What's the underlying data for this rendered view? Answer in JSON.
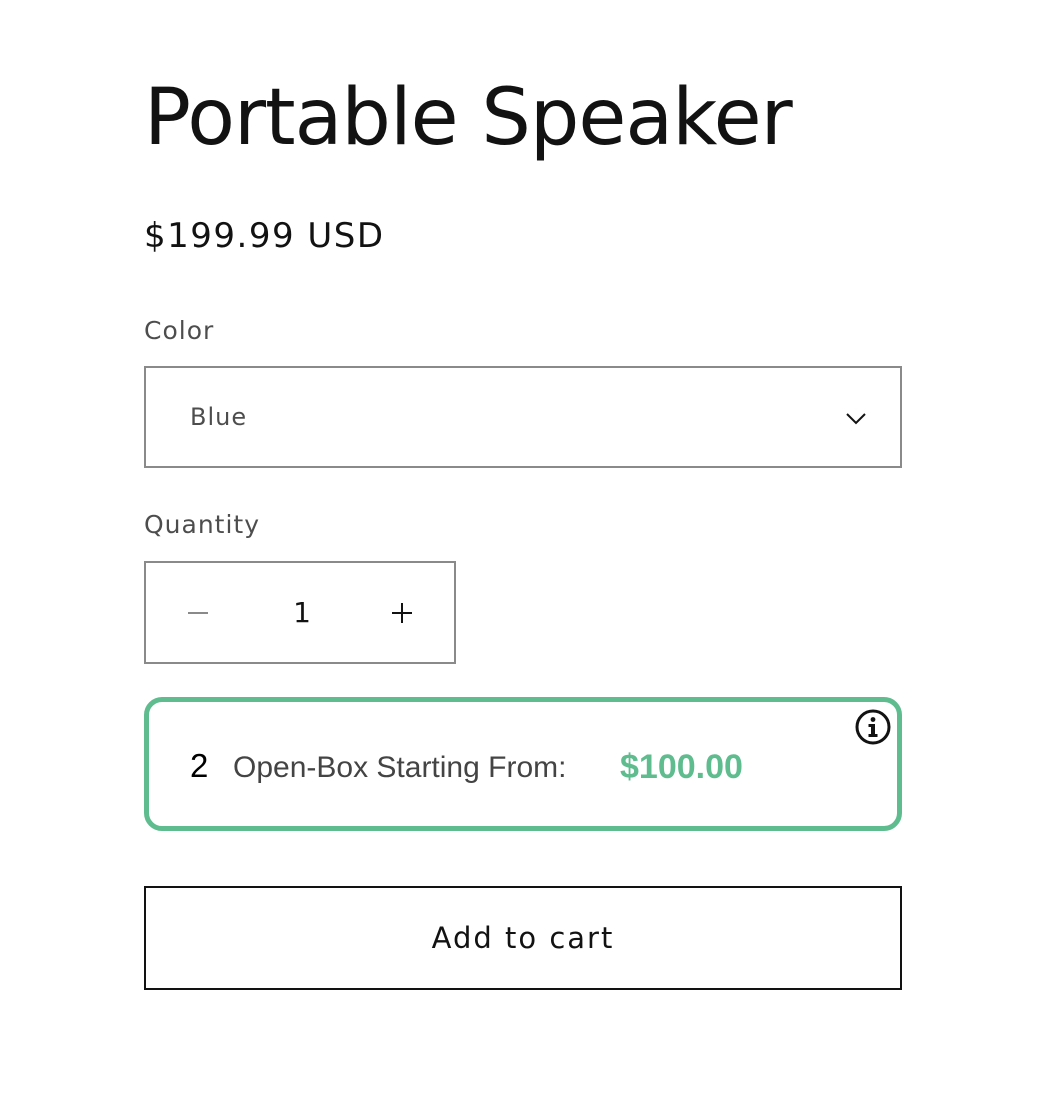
{
  "product": {
    "title": "Portable Speaker",
    "price": "$199.99 USD"
  },
  "color": {
    "label": "Color",
    "selected": "Blue",
    "icon": "chevron-down-icon"
  },
  "quantity": {
    "label": "Quantity",
    "value": "1",
    "decrease_icon": "minus-icon",
    "increase_icon": "plus-icon"
  },
  "open_box": {
    "count": "2",
    "text": "Open-Box Starting From:",
    "price": "$100.00",
    "icon": "info-icon",
    "accent_color": "#5ebc8e"
  },
  "cart": {
    "button_label": "Add to cart"
  }
}
